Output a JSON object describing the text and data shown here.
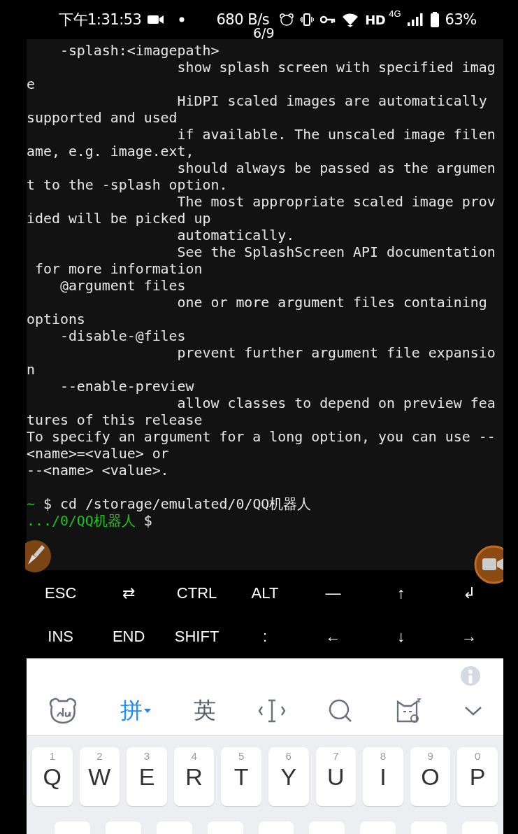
{
  "status_bar": {
    "time": "下午1:31:53",
    "network_speed": "680 B/s",
    "hd": "HD",
    "network_type": "4G",
    "battery": "63%"
  },
  "page_counter": "6/9",
  "terminal": {
    "output_lines": [
      "    -splash:<imagepath>",
      "                  show splash screen with specified imag",
      "e",
      "                  HiDPI scaled images are automatically",
      "supported and used",
      "                  if available. The unscaled image filen",
      "ame, e.g. image.ext,",
      "                  should always be passed as the argumen",
      "t to the -splash option.",
      "                  The most appropriate scaled image prov",
      "ided will be picked up",
      "                  automatically.",
      "                  See the SplashScreen API documentation",
      " for more information",
      "    @argument files",
      "                  one or more argument files containing",
      "options",
      "    -disable-@files",
      "                  prevent further argument file expansio",
      "n",
      "    --enable-preview",
      "                  allow classes to depend on preview fea",
      "tures of this release",
      "To specify an argument for a long option, you can use --",
      "<name>=<value> or",
      "--<name> <value>."
    ],
    "command": {
      "path": "~",
      "symbol": "$",
      "text": "cd /storage/emulated/0/QQ机器人"
    },
    "prompt": {
      "path": ".../0/QQ机器人",
      "symbol": "$"
    }
  },
  "extra_keys": [
    [
      "ESC",
      "⇄",
      "CTRL",
      "ALT",
      "—",
      "↑",
      "↲"
    ],
    [
      "INS",
      "END",
      "SHIFT",
      ":",
      "←",
      "↓",
      "→"
    ]
  ],
  "ime_toolbar": {
    "pinyin": "拼",
    "english": "英"
  },
  "keys": [
    {
      "hint": "1",
      "label": "Q"
    },
    {
      "hint": "2",
      "label": "W"
    },
    {
      "hint": "3",
      "label": "E"
    },
    {
      "hint": "4",
      "label": "R"
    },
    {
      "hint": "5",
      "label": "T"
    },
    {
      "hint": "6",
      "label": "Y"
    },
    {
      "hint": "7",
      "label": "U"
    },
    {
      "hint": "8",
      "label": "I"
    },
    {
      "hint": "9",
      "label": "O"
    },
    {
      "hint": "0",
      "label": "P"
    }
  ]
}
